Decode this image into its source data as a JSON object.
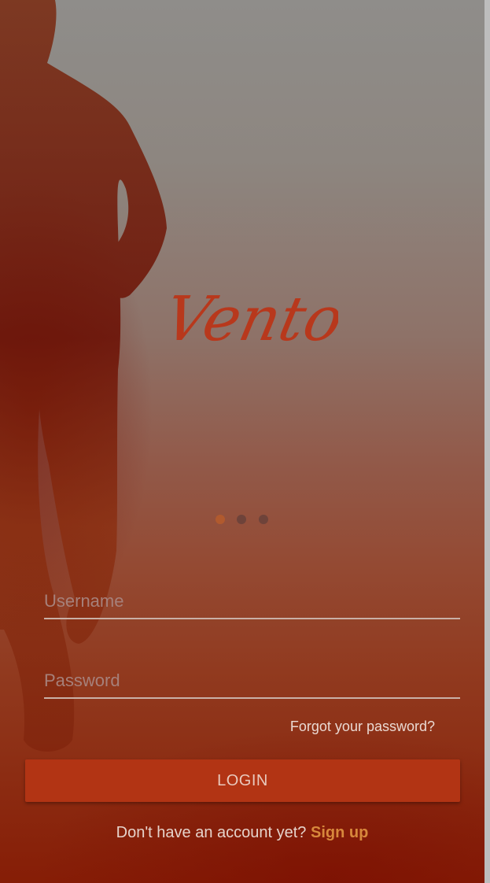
{
  "app": {
    "logo_text": "Vento"
  },
  "carousel": {
    "dot_count": 3,
    "active_index": 0
  },
  "form": {
    "username_placeholder": "Username",
    "password_placeholder": "Password",
    "forgot_label": "Forgot your password?",
    "login_label": "LOGIN"
  },
  "footer": {
    "prompt": "Don't have an account yet?",
    "signup_label": "Sign up"
  },
  "colors": {
    "accent": "#b23414",
    "link": "#d7883c",
    "logo": "#b8381c"
  }
}
